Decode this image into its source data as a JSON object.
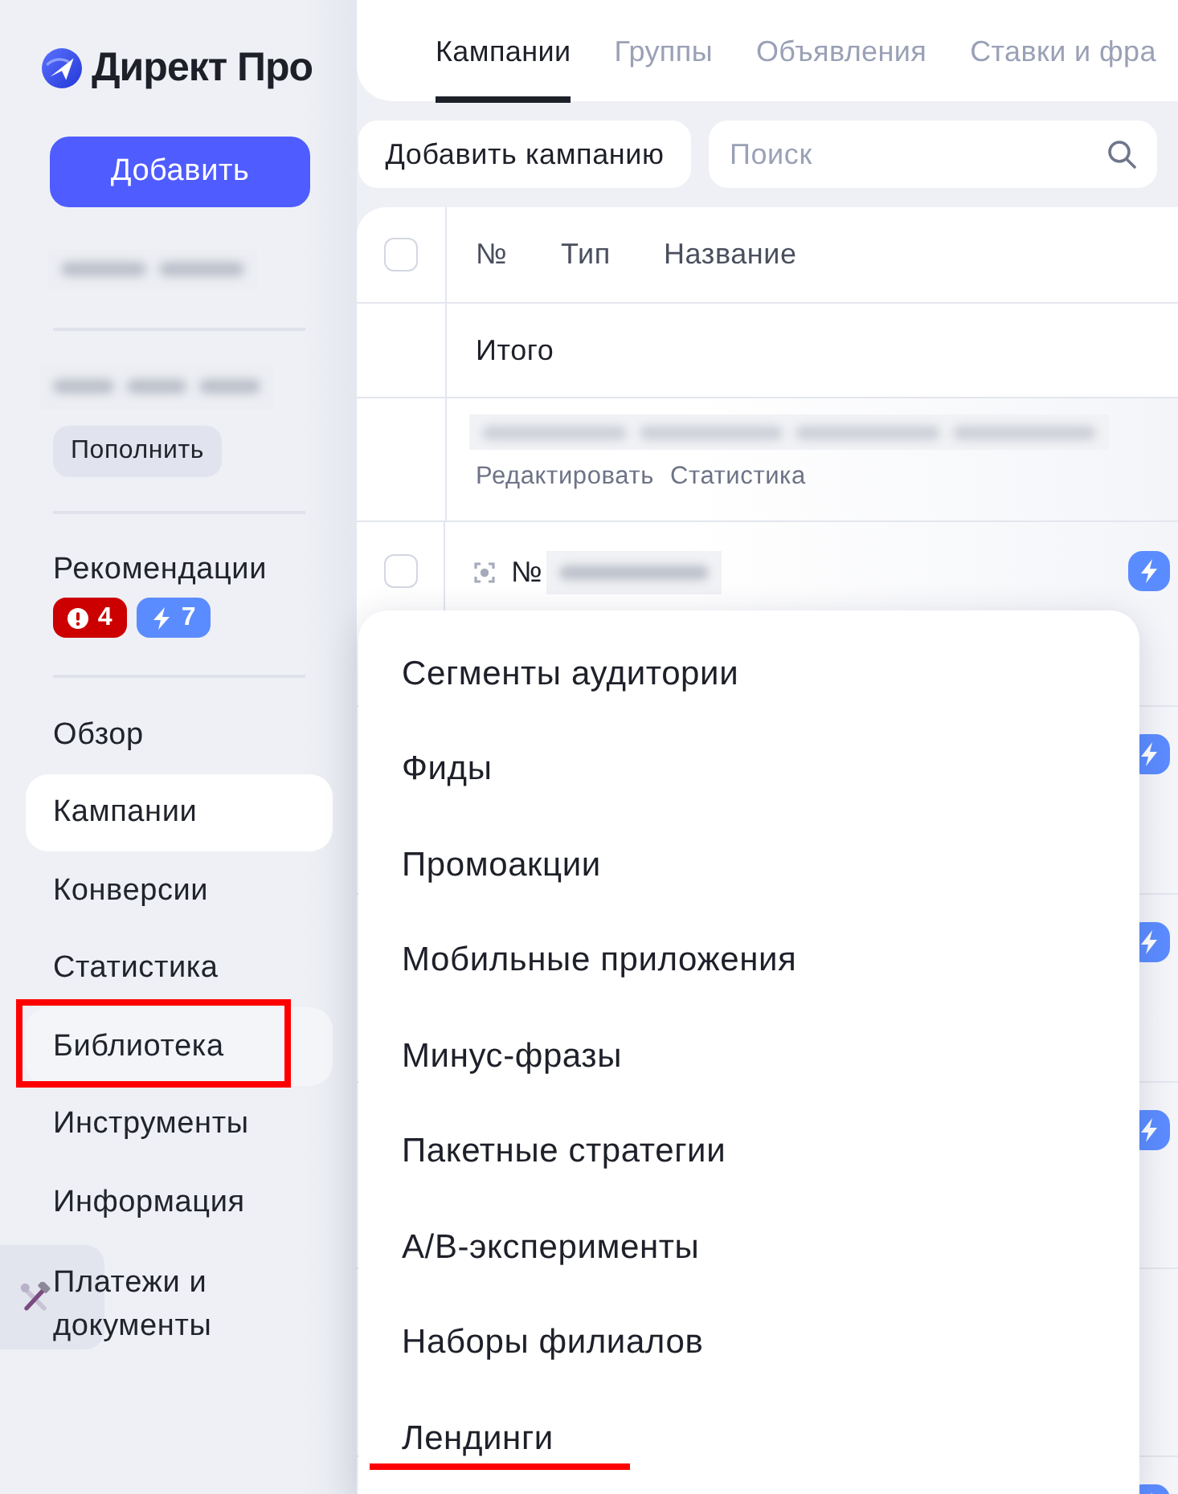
{
  "sidebar": {
    "logo": "Директ Про",
    "add_button": "Добавить",
    "top_up_button": "Пополнить",
    "recommendations": {
      "label": "Рекомендации",
      "badges": [
        {
          "kind": "alert",
          "count": "4"
        },
        {
          "kind": "boost",
          "count": "7"
        }
      ]
    },
    "nav": [
      {
        "label": "Обзор",
        "selected": false,
        "highlighted": false
      },
      {
        "label": "Кампании",
        "selected": true,
        "highlighted": false
      },
      {
        "label": "Конверсии",
        "selected": false,
        "highlighted": false
      },
      {
        "label": "Статистика",
        "selected": false,
        "highlighted": false
      },
      {
        "label": "Библиотека",
        "selected": false,
        "highlighted": true
      },
      {
        "label": "Инструменты",
        "selected": false,
        "highlighted": false
      },
      {
        "label": "Информация",
        "selected": false,
        "highlighted": false
      },
      {
        "label": "Платежи и документы",
        "selected": false,
        "highlighted": false
      }
    ]
  },
  "tabs": [
    {
      "label": "Кампании",
      "selected": true
    },
    {
      "label": "Группы",
      "selected": false
    },
    {
      "label": "Объявления",
      "selected": false
    },
    {
      "label": "Ставки и фра",
      "selected": false
    }
  ],
  "toolbar": {
    "add_campaign_button": "Добавить кампанию",
    "search": {
      "placeholder": "Поиск"
    }
  },
  "table": {
    "select_all_checked": false,
    "columns": [
      "№",
      "Тип",
      "Название"
    ],
    "total_label": "Итого",
    "rows": [
      {
        "kind": "actions",
        "links": [
          "Редактировать",
          "Статистика"
        ],
        "recommendation": false
      },
      {
        "kind": "campaign",
        "checked": false,
        "number_label": "№",
        "recommendation": true
      },
      {
        "kind": "covered",
        "recommendation": true
      },
      {
        "kind": "covered",
        "recommendation": true
      },
      {
        "kind": "covered",
        "recommendation": true
      },
      {
        "kind": "covered",
        "recommendation": false
      },
      {
        "kind": "covered",
        "recommendation": true
      }
    ]
  },
  "dropdown_menu": {
    "items": [
      {
        "label": "Сегменты аудитории",
        "highlighted": false
      },
      {
        "label": "Фиды",
        "highlighted": false
      },
      {
        "label": "Промоакции",
        "highlighted": false
      },
      {
        "label": "Мобильные приложения",
        "highlighted": false
      },
      {
        "label": "Минус-фразы",
        "highlighted": false
      },
      {
        "label": "Пакетные стратегии",
        "highlighted": false
      },
      {
        "label": "А/В-эксперименты",
        "highlighted": false
      },
      {
        "label": "Наборы филиалов",
        "highlighted": false
      },
      {
        "label": "Лендинги",
        "highlighted": true
      }
    ]
  }
}
